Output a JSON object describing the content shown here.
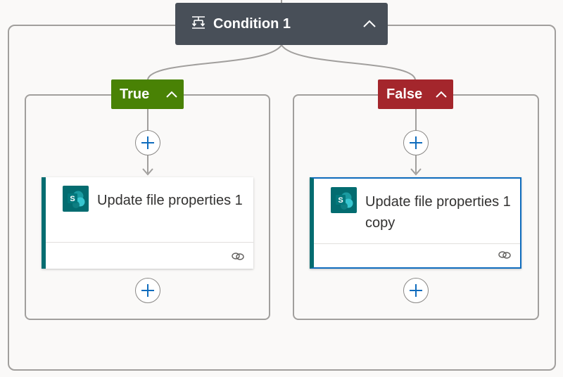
{
  "condition": {
    "title": "Condition 1"
  },
  "branches": [
    {
      "label": "True",
      "color": "#498205",
      "action": {
        "title": "Update file properties 1",
        "icon": "sharepoint-icon",
        "selected": false
      }
    },
    {
      "label": "False",
      "color": "#a4262c",
      "action": {
        "title": "Update file properties 1 copy",
        "icon": "sharepoint-icon",
        "selected": true
      }
    }
  ],
  "colors": {
    "canvas": "#faf9f8",
    "condition_header": "#484f58",
    "sharepoint": "#036c70",
    "selection": "#0f6cbd",
    "add_button_plus": "#0f6cbd"
  }
}
